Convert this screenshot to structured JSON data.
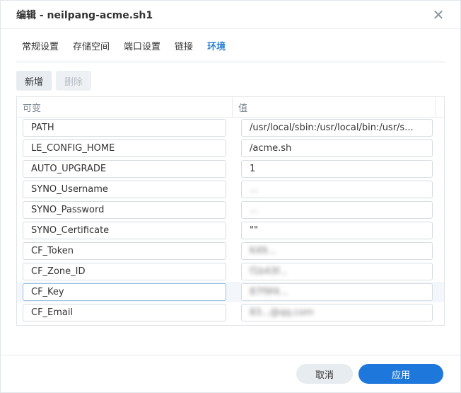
{
  "window": {
    "title": "编辑 - neilpang-acme.sh1"
  },
  "tabs": [
    {
      "label": "常规设置"
    },
    {
      "label": "存储空间"
    },
    {
      "label": "端口设置"
    },
    {
      "label": "链接"
    },
    {
      "label": "环境"
    }
  ],
  "toolbar": {
    "add_label": "新增",
    "delete_label": "删除"
  },
  "table": {
    "headers": [
      "可变",
      "值"
    ],
    "rows": [
      {
        "name": "PATH",
        "value": "/usr/local/sbin:/usr/local/bin:/usr/s..."
      },
      {
        "name": "LE_CONFIG_HOME",
        "value": "/acme.sh"
      },
      {
        "name": "AUTO_UPGRADE",
        "value": "1"
      },
      {
        "name": "SYNO_Username",
        "value": "..."
      },
      {
        "name": "SYNO_Password",
        "value": "..."
      },
      {
        "name": "SYNO_Certificate",
        "value": "\"\""
      },
      {
        "name": "CF_Token",
        "value": "K49..."
      },
      {
        "name": "CF_Zone_ID",
        "value": "f1b43f..."
      },
      {
        "name": "CF_Key",
        "value": "87f9f4..."
      },
      {
        "name": "CF_Email",
        "value": "83...@qq.com"
      }
    ]
  },
  "footer": {
    "cancel_label": "取消",
    "apply_label": "应用"
  },
  "colors": {
    "accent": "#1e78dc",
    "active_tab": "#2a7fd4"
  }
}
